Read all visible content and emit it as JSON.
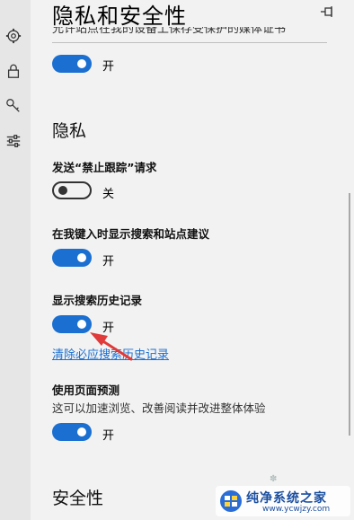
{
  "panel": {
    "title": "隐私和安全性",
    "clipped_text": "允许站点在我的设备上保存受保护的媒体证书"
  },
  "media_toggle": {
    "state": "开",
    "on": true
  },
  "privacy": {
    "heading": "隐私",
    "dnt": {
      "label": "发送“禁止跟踪”请求",
      "state": "关",
      "on": false
    },
    "suggestions": {
      "label": "在我键入时显示搜索和站点建议",
      "state": "开",
      "on": true
    },
    "history": {
      "label": "显示搜索历史记录",
      "state": "开",
      "on": true,
      "link": "清除必应搜索历史记录"
    },
    "prediction": {
      "label": "使用页面预测",
      "desc": "这可以加速浏览、改善阅读并改进整体体验",
      "state": "开",
      "on": true
    }
  },
  "security": {
    "heading": "安全性"
  },
  "sidebar": {
    "icons": [
      "gear-icon",
      "lock-icon",
      "key-icon",
      "sliders-icon"
    ]
  },
  "watermark": {
    "title": "纯净系统之家",
    "url": "www.ycwjzy.com"
  },
  "colors": {
    "accent": "#1a6fd1",
    "arrow": "#e03a3a"
  }
}
